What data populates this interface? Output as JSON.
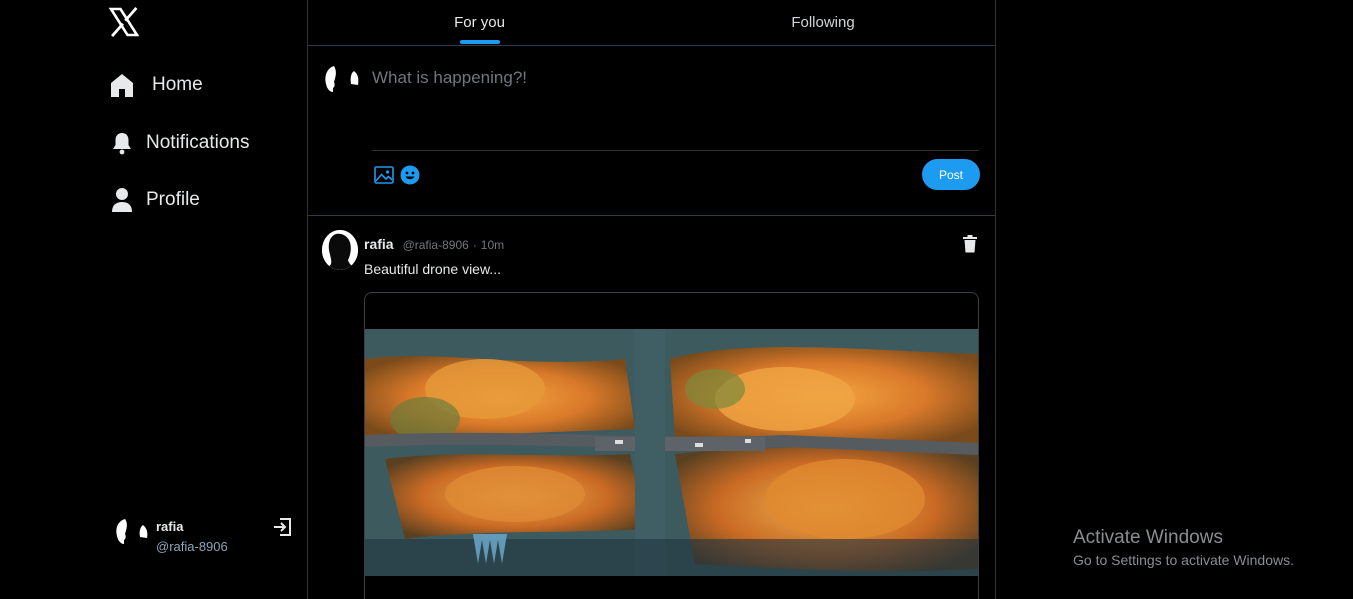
{
  "sidebar": {
    "logo_icon": "x-logo-icon",
    "items": [
      {
        "label": "Home",
        "icon": "home-icon"
      },
      {
        "label": "Notifications",
        "icon": "bell-icon"
      },
      {
        "label": "Profile",
        "icon": "user-icon"
      }
    ],
    "account": {
      "name": "rafia",
      "handle": "@rafia-8906",
      "logout_icon": "logout-icon"
    }
  },
  "tabs": [
    {
      "label": "For you",
      "active": true
    },
    {
      "label": "Following",
      "active": false
    }
  ],
  "composer": {
    "placeholder": "What is happening?!",
    "post_label": "Post",
    "accent": "#1d9bf0"
  },
  "tweet": {
    "name": "rafia",
    "handle": "@rafia-8906",
    "separator": "·",
    "time": "10m",
    "text": "Beautiful drone view..."
  },
  "watermark": {
    "title": "Activate Windows",
    "subtitle": "Go to Settings to activate Windows."
  }
}
